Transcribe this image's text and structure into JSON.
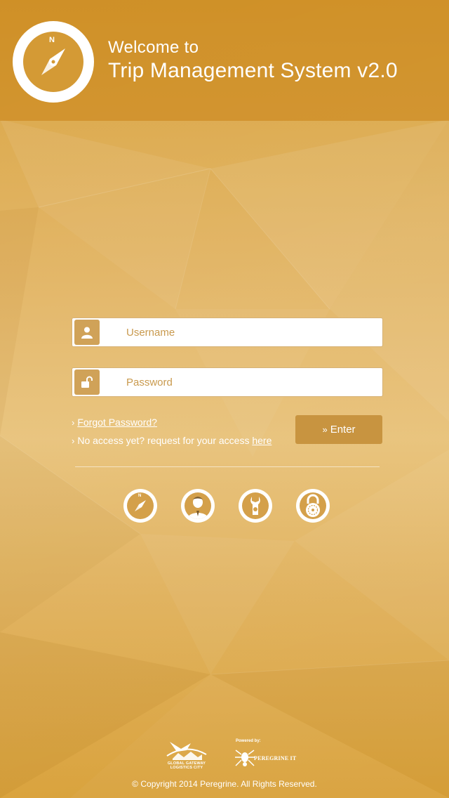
{
  "header": {
    "welcome": "Welcome to",
    "title": "Trip Management System v2.0",
    "logo_icon": "compass-icon",
    "logo_letter": "N"
  },
  "login": {
    "username_placeholder": "Username",
    "password_placeholder": "Password",
    "username_icon": "user-icon",
    "password_icon": "unlock-icon",
    "forgot_password": "Forgot Password?",
    "no_access_text": "No access yet? request for your access",
    "here_link": "here",
    "enter_label": "Enter",
    "enter_icon": "double-chevron-right-icon"
  },
  "quick_icons": [
    {
      "name": "compass-icon",
      "letter": "N"
    },
    {
      "name": "businessman-icon"
    },
    {
      "name": "wrench-icon"
    },
    {
      "name": "padlock-icon"
    }
  ],
  "footer": {
    "partner_logo_text": "GLOBAL GATEWAY LOGISTICS CITY",
    "powered_by": "Powered by:",
    "peregrine": "PEREGRINE IT",
    "copyright": "© Copyright 2014 Peregrine. All Rights Reserved."
  },
  "colors": {
    "background": "#d9a23f",
    "accent": "#c89440"
  }
}
